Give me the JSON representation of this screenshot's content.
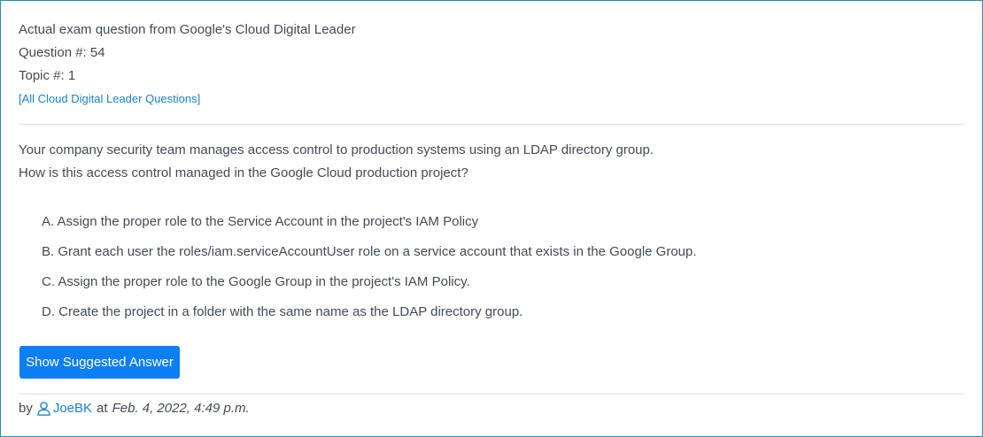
{
  "header": {
    "source_line": "Actual exam question from Google's Cloud Digital Leader",
    "question_number": "Question #: 54",
    "topic_number": "Topic #: 1",
    "all_questions_link": "[All Cloud Digital Leader Questions]"
  },
  "question": {
    "line1": "Your company security team manages access control to production systems using an LDAP directory group.",
    "line2": "How is this access control managed in the Google Cloud production project?"
  },
  "choices": [
    "A. Assign the proper role to the Service Account in the project's IAM Policy",
    "B. Grant each user the roles/iam.serviceAccountUser role on a service account that exists in the Google Group.",
    "C. Assign the proper role to the Google Group in the project's IAM Policy.",
    "D. Create the project in a folder with the same name as the LDAP directory group."
  ],
  "actions": {
    "show_answer_label": "Show Suggested Answer"
  },
  "footer": {
    "by_label": "by",
    "user_icon": "user-icon",
    "username": "JoeBK",
    "at_label": "at",
    "date": "Feb. 4, 2022, 4:49 p.m."
  },
  "colors": {
    "accent": "#0d7ff2",
    "link": "#1a82c8",
    "border": "#1e90b8",
    "text": "#444a52"
  }
}
